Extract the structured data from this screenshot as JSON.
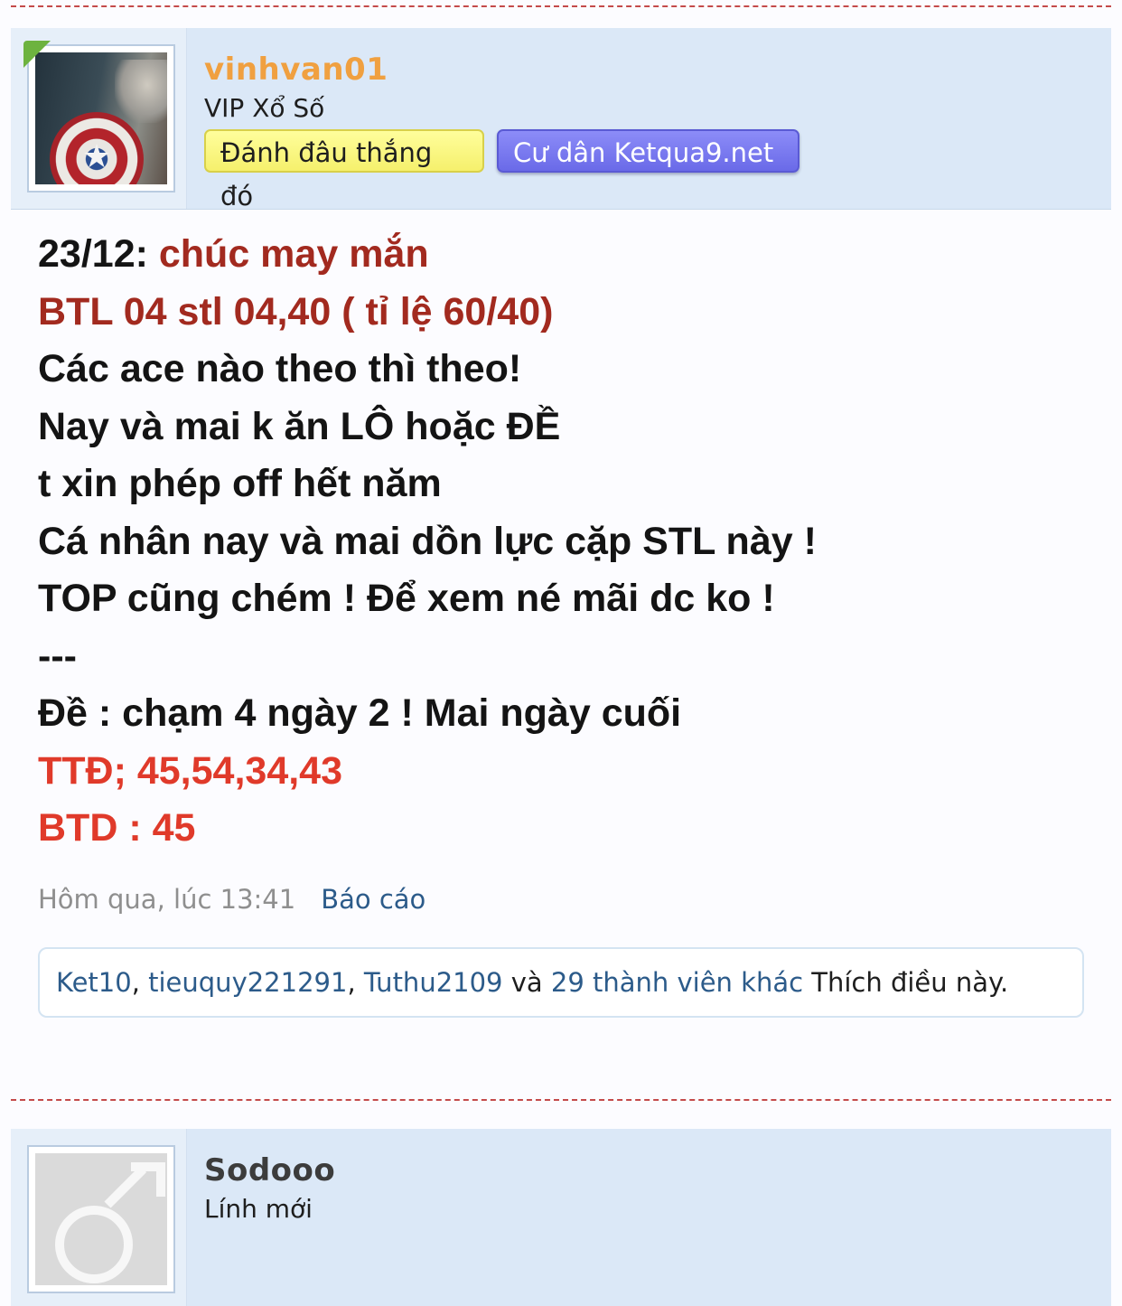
{
  "post": {
    "author": {
      "username": "vinhvan01",
      "username_color": "#f0a040",
      "title": "VIP Xổ Số",
      "badges": [
        {
          "label": "Đánh đâu thắng đó",
          "color": "#fff98a"
        },
        {
          "label": "Cư dân Ketqua9.net",
          "color": "#7878ef"
        }
      ]
    },
    "lines": [
      {
        "prefix": "23/12: ",
        "text": "chúc may mắn"
      },
      {
        "text": "BTL 04 stl 04,40 ( tỉ lệ 60/40)"
      },
      {
        "text": "Các ace nào theo thì theo!"
      },
      {
        "text": "Nay và mai k ăn LÔ hoặc ĐỀ"
      },
      {
        "text": "t xin phép off hết năm"
      },
      {
        "text": "Cá nhân nay và mai dồn lực cặp STL này !"
      },
      {
        "text": "TOP cũng chém ! Để xem né mãi dc ko !"
      },
      {
        "text": "---"
      },
      {
        "text": "Đề : chạm 4 ngày 2 ! Mai ngày cuối"
      },
      {
        "text": "TTĐ; 45,54,34,43"
      },
      {
        "text": "BTD : 45"
      }
    ],
    "timestamp": "Hôm qua, lúc 13:41",
    "report_label": "Báo cáo",
    "likes": {
      "users": [
        "Ket10",
        "tieuquy221291",
        "Tuthu2109"
      ],
      "separator": ", ",
      "and_word": " và ",
      "others_link": "29 thành viên khác",
      "suffix": " Thích điều này."
    }
  },
  "next_post": {
    "author": {
      "username": "Sodooo",
      "title": "Lính mới"
    }
  }
}
